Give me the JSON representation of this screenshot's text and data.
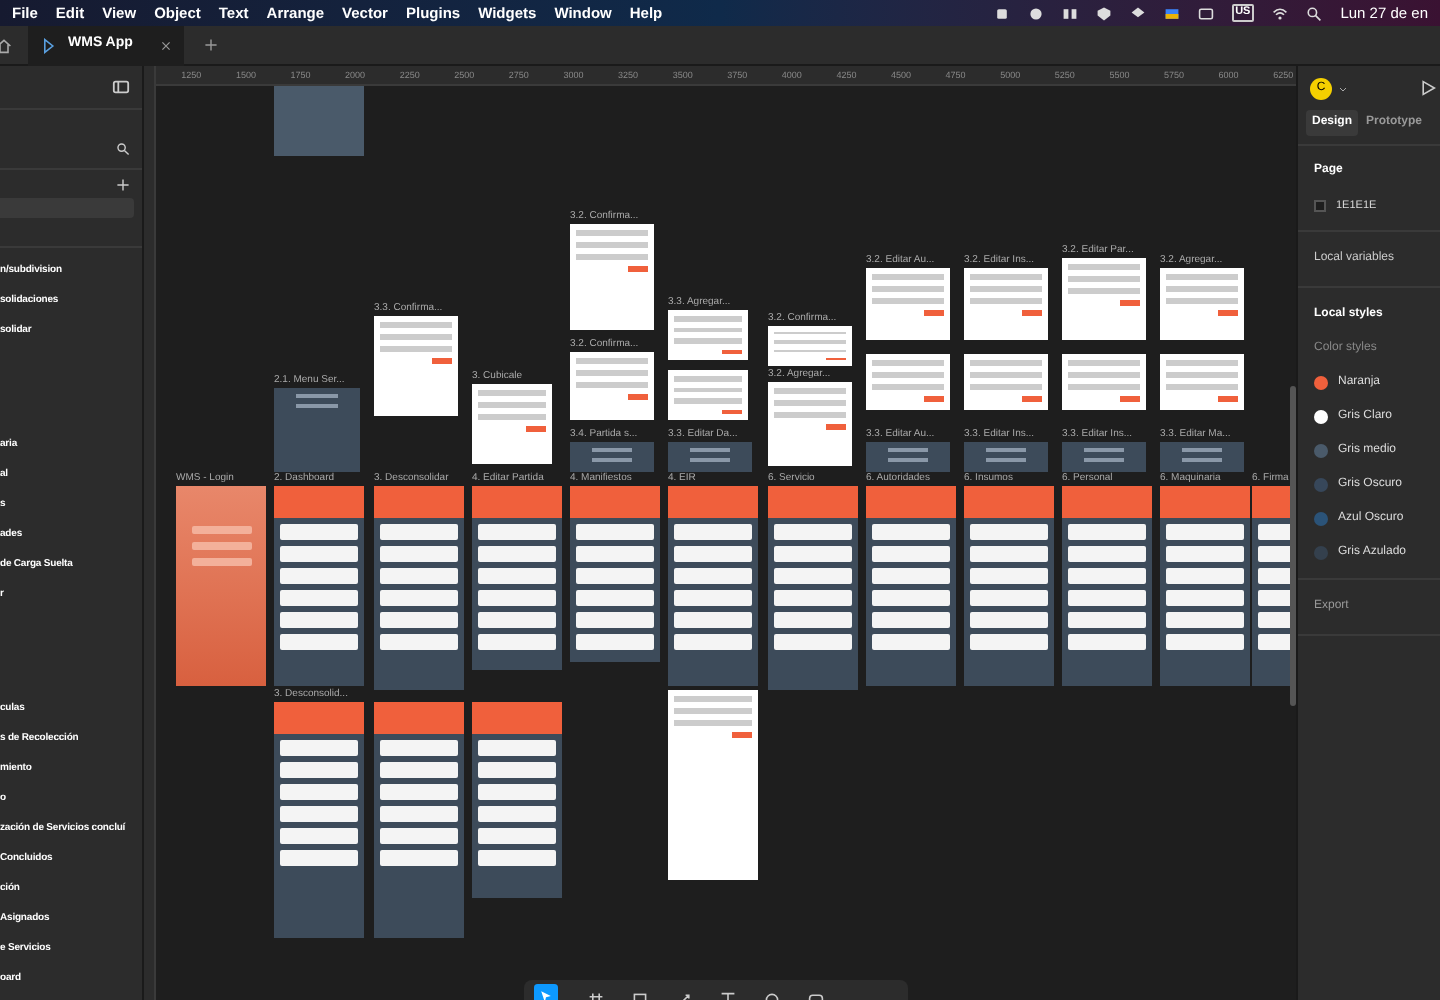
{
  "menu_bar": {
    "menus": [
      "File",
      "Edit",
      "View",
      "Object",
      "Text",
      "Arrange",
      "Vector",
      "Plugins",
      "Widgets",
      "Window",
      "Help"
    ],
    "keyboard": "US",
    "clock": "Lun 27 de en"
  },
  "tabs": [
    {
      "label": "WMS App",
      "selected": true
    }
  ],
  "layers": [
    [
      "n/subdivision",
      "solidaciones",
      "solidar"
    ],
    [
      "aria",
      "al",
      "s",
      "ades",
      "de Carga Suelta",
      "r"
    ],
    [
      "culas",
      "s de Recolección",
      "miento",
      "o",
      "zación de Servicios concluí",
      "Concluidos",
      "ción",
      "Asignados",
      "e Servicios",
      "oard"
    ]
  ],
  "ruler": [
    "1250",
    "1500",
    "1750",
    "2000",
    "2250",
    "2500",
    "2750",
    "3000",
    "3250",
    "3500",
    "3750",
    "4000",
    "4250",
    "4500",
    "4750",
    "5000",
    "5250",
    "5500",
    "5750",
    "6000",
    "6250"
  ],
  "frames": [
    {
      "kind": "blank"
    },
    {
      "label": "3.2. Confirma...",
      "kind": "dialog"
    },
    {
      "label": "3.2. Editar Au...",
      "kind": "dialog"
    },
    {
      "label": "3.2. Editar Ins...",
      "kind": "dialog"
    },
    {
      "label": "3.2. Editar Par...",
      "kind": "dialog"
    },
    {
      "label": "3.2. Agregar...",
      "kind": "dialog"
    },
    {
      "label": "3.3. Confirma...",
      "kind": "dialog"
    },
    {
      "label": "3.3. Agregar...",
      "kind": "dialog"
    },
    {
      "label": "3.2. Confirma...",
      "kind": "dialog"
    },
    {
      "label": "3.2. Confirma...",
      "kind": "dialog"
    },
    {
      "kind": "dialog"
    },
    {
      "kind": "dialog"
    },
    {
      "kind": "dialog"
    },
    {
      "kind": "dialog"
    },
    {
      "label": "2.1. Menu Ser...",
      "kind": "menu"
    },
    {
      "label": "3. Cubicale",
      "kind": "dialog"
    },
    {
      "kind": "dialog"
    },
    {
      "label": "3.2. Agregar...",
      "kind": "dialog"
    },
    {
      "label": "3.4. Partida s...",
      "kind": "menu"
    },
    {
      "label": "3.3. Editar Da...",
      "kind": "menu"
    },
    {
      "label": "3.3. Editar Au...",
      "kind": "menu"
    },
    {
      "label": "3.3. Editar Ins...",
      "kind": "menu"
    },
    {
      "label": "3.3. Editar Ins...",
      "kind": "menu"
    },
    {
      "label": "3.3. Editar Ma...",
      "kind": "menu"
    },
    {
      "label": "WMS - Login",
      "kind": "login"
    },
    {
      "label": "2. Dashboard",
      "kind": "phone"
    },
    {
      "label": "3. Desconsolidar",
      "kind": "phone"
    },
    {
      "label": "4. Editar Partida",
      "kind": "phone"
    },
    {
      "label": "4. Manifiestos",
      "kind": "phone"
    },
    {
      "label": "4. EIR",
      "kind": "phone"
    },
    {
      "label": "6. Servicio",
      "kind": "phone"
    },
    {
      "label": "6. Autoridades",
      "kind": "phone"
    },
    {
      "label": "6. Insumos",
      "kind": "phone"
    },
    {
      "label": "6. Personal",
      "kind": "phone"
    },
    {
      "label": "6. Maquinaria",
      "kind": "phone"
    },
    {
      "label": "6. Firma",
      "kind": "phone"
    },
    {
      "label": "3. Desconsolid...",
      "kind": "phone"
    },
    {
      "kind": "phone"
    },
    {
      "kind": "phone"
    },
    {
      "kind": "dialog"
    }
  ],
  "right_panel": {
    "avatar": "C",
    "tabs": [
      {
        "label": "Design",
        "selected": true
      },
      {
        "label": "Prototype",
        "selected": false
      }
    ],
    "page_heading": "Page",
    "page_color": "1E1E1E",
    "local_variables": "Local variables",
    "local_styles": "Local styles",
    "color_styles_heading": "Color styles",
    "color_styles": [
      {
        "name": "Naranja",
        "color": "#f0603c"
      },
      {
        "name": "Gris Claro",
        "color": "#ffffff"
      },
      {
        "name": "Gris medio",
        "color": "#4a5a6a"
      },
      {
        "name": "Gris Oscuro",
        "color": "#37475a"
      },
      {
        "name": "Azul Oscuro",
        "color": "#2b5378"
      },
      {
        "name": "Gris Azulado",
        "color": "#34404d"
      }
    ],
    "export": "Export"
  }
}
